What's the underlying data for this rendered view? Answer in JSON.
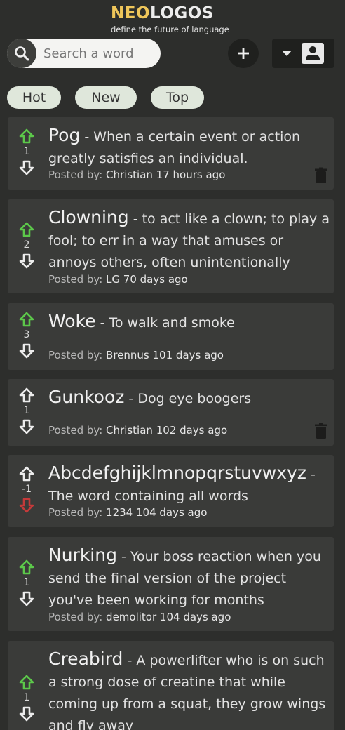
{
  "header": {
    "logo_neo": "NEO",
    "logo_logos": "LOGOS",
    "tagline": "define the future of language",
    "search_placeholder": "Search a word",
    "icons": [
      "search-icon",
      "plus-icon",
      "caret-down-icon",
      "account-box-icon"
    ]
  },
  "tabs": [
    {
      "label": "Hot"
    },
    {
      "label": "New"
    },
    {
      "label": "Top"
    }
  ],
  "colors": {
    "background": "#2d2e2c",
    "card": "#3a3b39",
    "brand_yellow": "#efc65a",
    "upvote_active": "#5cc84a",
    "downvote_active": "#c43a3a",
    "neutral_arrow": "#ececec",
    "tab_bg": "#dfe7db",
    "trash": "#1c1c1b"
  },
  "posts": [
    {
      "word": "Pog",
      "definition": "- When a certain event or action greatly satisfies an individual.",
      "posted_by_label": "Posted by:",
      "meta": "Christian 17 hours ago",
      "score": "1",
      "vote": "up",
      "deletable": true
    },
    {
      "word": "Clowning",
      "definition": "- to act like a clown; to play a fool; to err in a way that amuses or annoys others, often unintentionally",
      "posted_by_label": "Posted by:",
      "meta": "LG 70 days ago",
      "score": "2",
      "vote": "up",
      "deletable": false
    },
    {
      "word": "Woke",
      "definition": "- To walk and smoke",
      "posted_by_label": "Posted by:",
      "meta": "Brennus 101 days ago",
      "score": "3",
      "vote": "up",
      "deletable": false
    },
    {
      "word": "Gunkooz",
      "definition": "- Dog eye boogers",
      "posted_by_label": "Posted by:",
      "meta": "Christian 102 days ago",
      "score": "1",
      "vote": "none",
      "deletable": true
    },
    {
      "word": "Abcdefghijklmnopqrstuvwxyz",
      "definition": "- The word containing all words",
      "posted_by_label": "Posted by:",
      "meta": "1234 104 days ago",
      "score": "-1",
      "vote": "down",
      "deletable": false
    },
    {
      "word": "Nurking",
      "definition": "- Your boss reaction when you send the final version of the project you've been working for months",
      "posted_by_label": "Posted by:",
      "meta": "demolitor 104 days ago",
      "score": "1",
      "vote": "up",
      "deletable": false
    },
    {
      "word": "Creabird",
      "definition": "- A powerlifter who is on such a strong dose of creatine that while coming up from a squat, they grow wings and fly away",
      "posted_by_label": "",
      "meta": "",
      "score": "1",
      "vote": "up",
      "deletable": false
    }
  ]
}
